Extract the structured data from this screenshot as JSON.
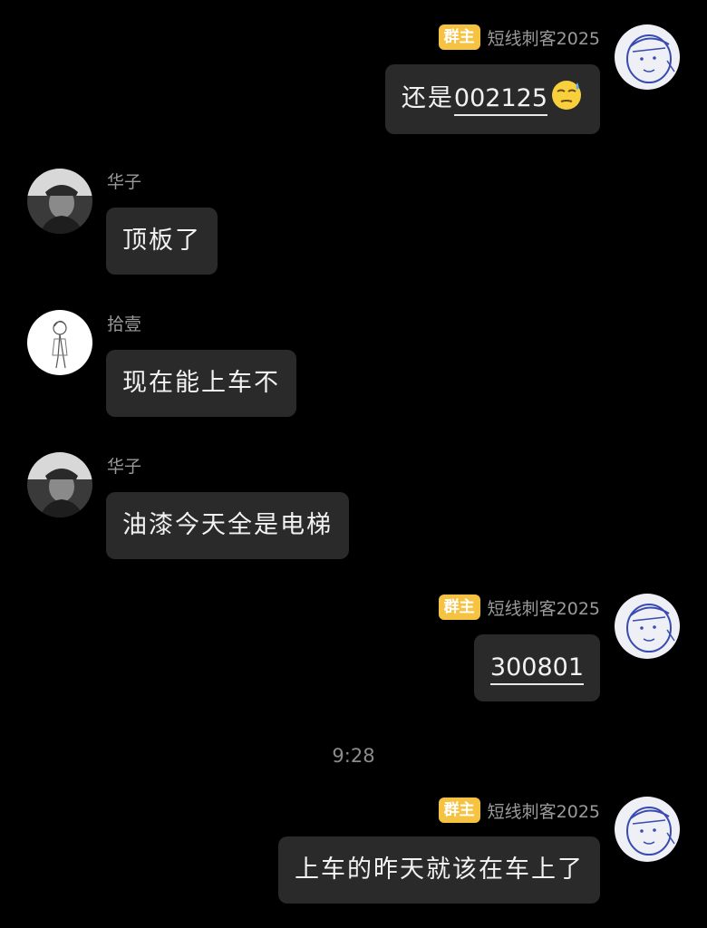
{
  "messages": [
    {
      "sender_badge": "群主",
      "sender_name": "短线刺客2025",
      "text_prefix": "还是",
      "link_text": "002125",
      "emoji": "cold-sweat-face-emoji"
    },
    {
      "sender_name": "华子",
      "text": "顶板了"
    },
    {
      "sender_name": "拾壹",
      "text": "现在能上车不"
    },
    {
      "sender_name": "华子",
      "text": "油漆今天全是电梯"
    },
    {
      "sender_badge": "群主",
      "sender_name": "短线刺客2025",
      "link_text": "300801"
    },
    {
      "sender_badge": "群主",
      "sender_name": "短线刺客2025",
      "text": "上车的昨天就该在车上了"
    }
  ],
  "time_separator": "9:28",
  "colors": {
    "background": "#000000",
    "bubble": "#2a2a2a",
    "badge": "#f5c242",
    "name_text": "#9a9a9a",
    "message_text": "#f2f2f2"
  }
}
